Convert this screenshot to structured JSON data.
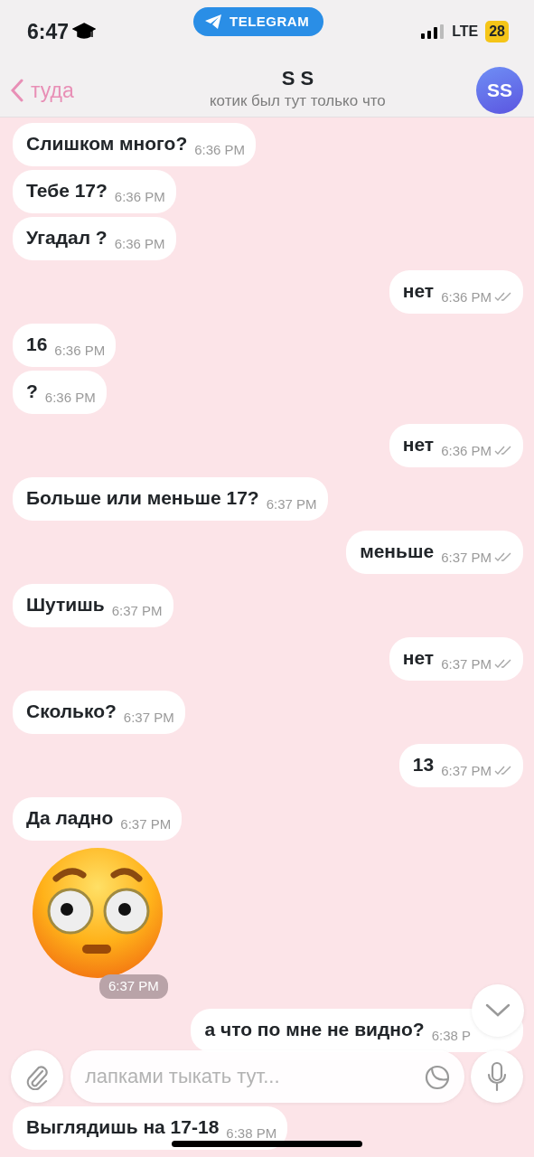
{
  "status_bar": {
    "time": "6:47",
    "app_pill": "TELEGRAM",
    "network": "LTE",
    "battery": "28"
  },
  "header": {
    "back_label": "туда",
    "title": "S S",
    "subtitle": "котик был тут только что",
    "avatar_initials": "SS"
  },
  "messages": [
    {
      "kind": "text",
      "outgoing": false,
      "text": "Слишком много?",
      "time": "6:36 PM"
    },
    {
      "kind": "text",
      "outgoing": false,
      "text": "Тебе 17?",
      "time": "6:36 PM"
    },
    {
      "kind": "text",
      "outgoing": false,
      "text": "Угадал ?",
      "time": "6:36 PM"
    },
    {
      "kind": "text",
      "outgoing": true,
      "text": "нет",
      "time": "6:36 PM",
      "read": true
    },
    {
      "kind": "text",
      "outgoing": false,
      "text": "16",
      "time": "6:36 PM"
    },
    {
      "kind": "text",
      "outgoing": false,
      "text": "?",
      "time": "6:36 PM"
    },
    {
      "kind": "text",
      "outgoing": true,
      "text": "нет",
      "time": "6:36 PM",
      "read": true
    },
    {
      "kind": "text",
      "outgoing": false,
      "text": "Больше или меньше 17?",
      "time": "6:37 PM"
    },
    {
      "kind": "text",
      "outgoing": true,
      "text": "меньше",
      "time": "6:37 PM",
      "read": true
    },
    {
      "kind": "text",
      "outgoing": false,
      "text": "Шутишь",
      "time": "6:37 PM"
    },
    {
      "kind": "text",
      "outgoing": true,
      "text": "нет",
      "time": "6:37 PM",
      "read": true
    },
    {
      "kind": "text",
      "outgoing": false,
      "text": "Сколько?",
      "time": "6:37 PM"
    },
    {
      "kind": "text",
      "outgoing": true,
      "text": "13",
      "time": "6:37 PM",
      "read": true
    },
    {
      "kind": "text",
      "outgoing": false,
      "text": "Да ладно",
      "time": "6:37 PM"
    },
    {
      "kind": "sticker",
      "outgoing": false,
      "time": "6:37 PM"
    },
    {
      "kind": "text",
      "outgoing": true,
      "text": "а что по мне не видно?",
      "time": "6:38 P",
      "under_scroll_button": true
    },
    {
      "kind": "text",
      "outgoing": false,
      "text": "Выглядишь на 17-18",
      "time": "6:38 PM"
    }
  ],
  "composer": {
    "placeholder": "лапками тыкать тут..."
  }
}
